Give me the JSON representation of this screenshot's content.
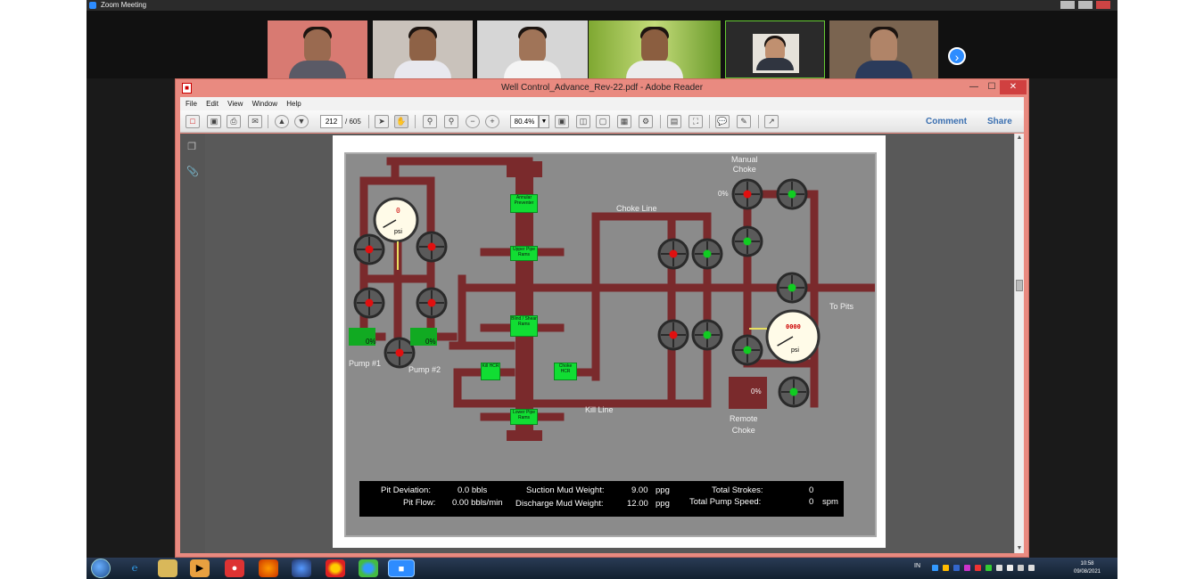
{
  "zoom": {
    "title": "Zoom Meeting",
    "next_label": "›"
  },
  "reader": {
    "title": "Well Control_Advance_Rev-22.pdf - Adobe Reader",
    "minimize": "—",
    "maximize": "☐",
    "close": "✕",
    "menu": [
      "File",
      "Edit",
      "View",
      "Window",
      "Help"
    ],
    "page_current": "212",
    "page_total": "/ 605",
    "zoom_level": "80.4%",
    "comment_label": "Comment",
    "share_label": "Share"
  },
  "simulator": {
    "manual_choke_label_1": "Manual",
    "manual_choke_label_2": "Choke",
    "manual_choke_pct": "0%",
    "choke_line_label": "Choke Line",
    "kill_line_label": "Kill Line",
    "to_pits_label": "To Pits",
    "pump1_label": "Pump #1",
    "pump2_label": "Pump #2",
    "pump1_pct": "0%",
    "pump2_pct": "0%",
    "remote_choke_label_1": "Remote",
    "remote_choke_label_2": "Choke",
    "remote_choke_pct": "0%",
    "gauge_left_value": "0",
    "gauge_left_unit": "psi",
    "gauge_right_value": "0000",
    "gauge_right_unit": "psi",
    "annular": "Annular Preventer",
    "upper_rams": "Upper Pipe Rams",
    "blind_rams": "Blind / Shear Rams",
    "lower_rams": "Lower Pipe Rams",
    "kill_hcr": "Kill HCR",
    "choke_hcr": "Choke HCR",
    "status": {
      "pit_deviation_label": "Pit Deviation:",
      "pit_deviation_value": "0.0 bbls",
      "pit_flow_label": "Pit Flow:",
      "pit_flow_value": "0.00 bbls/min",
      "suction_label": "Suction Mud Weight:",
      "suction_value": "9.00",
      "suction_unit": "ppg",
      "discharge_label": "Discharge Mud Weight:",
      "discharge_value": "12.00",
      "discharge_unit": "ppg",
      "total_strokes_label": "Total Strokes:",
      "total_strokes_value": "0",
      "pump_speed_label": "Total Pump Speed:",
      "pump_speed_value": "0",
      "pump_speed_unit": "spm"
    }
  },
  "taskbar": {
    "lang": "IN",
    "time": "10:58",
    "date": "09/08/2021"
  },
  "colors": {
    "pipe": "#7a2a2c",
    "valve_red": "#e01010",
    "valve_green": "#11cc22",
    "bop_green": "#11dd33",
    "accent_zoom": "#2d8cff"
  }
}
